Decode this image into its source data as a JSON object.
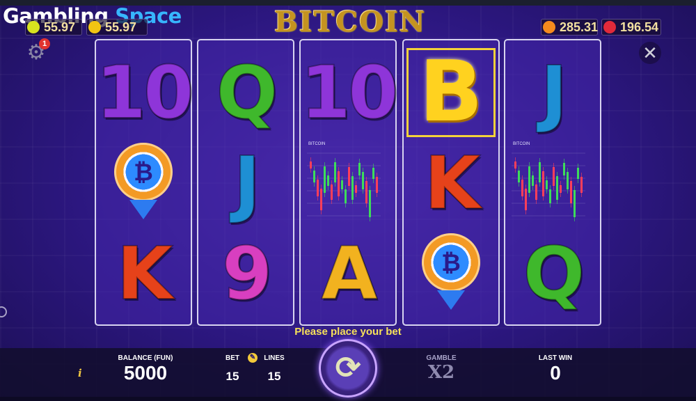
{
  "brand": {
    "part1": "Gambling",
    "part2": "Space"
  },
  "game_title": "BITCOIN",
  "top_counters": [
    {
      "fruit": "lemon",
      "color": "#d8e41f",
      "value": "55.97"
    },
    {
      "fruit": "lemon",
      "color": "#f2c413",
      "value": "55.97"
    },
    {
      "fruit": "orange",
      "color": "#f48a1d",
      "value": "285.31"
    },
    {
      "fruit": "strawberry",
      "color": "#e12a3a",
      "value": "196.54"
    }
  ],
  "settings": {
    "icon": "gear-icon",
    "glyph": "⚙",
    "badge": "1"
  },
  "close": {
    "glyph": "✕"
  },
  "reels": [
    [
      {
        "type": "letter",
        "text": "10",
        "color": "#8e35d9"
      },
      {
        "type": "chip",
        "text": "₿"
      },
      {
        "type": "letter",
        "text": "K",
        "color": "#e6421a"
      }
    ],
    [
      {
        "type": "letter",
        "text": "Q",
        "color": "#3fb82c"
      },
      {
        "type": "letter",
        "text": "J",
        "color": "#1e8fd4"
      },
      {
        "type": "letter",
        "text": "9",
        "color": "#d83fc0"
      }
    ],
    [
      {
        "type": "letter",
        "text": "10",
        "color": "#8e35d9"
      },
      {
        "type": "chart",
        "text": "BITCOIN"
      },
      {
        "type": "letter",
        "text": "A",
        "color": "#f2b21f"
      }
    ],
    [
      {
        "type": "bitcoin",
        "text": "B"
      },
      {
        "type": "letter",
        "text": "K",
        "color": "#e6421a"
      },
      {
        "type": "chip",
        "text": "₿"
      }
    ],
    [
      {
        "type": "letter",
        "text": "J",
        "color": "#1e8fd4"
      },
      {
        "type": "chart",
        "text": "BITCOIN"
      },
      {
        "type": "letter",
        "text": "Q",
        "color": "#3fb82c"
      }
    ]
  ],
  "prompt": "Please place your bet",
  "footer": {
    "info": "i",
    "balance_label": "BALANCE (FUN)",
    "balance_value": "5000",
    "bet_label": "BET",
    "bet_value": "15",
    "lines_label": "LINES",
    "lines_value": "15",
    "gamble_label": "GAMBLE",
    "gamble_value": "X2",
    "last_win_label": "LAST WIN",
    "last_win_value": "0",
    "spin_glyph": "⟳"
  }
}
